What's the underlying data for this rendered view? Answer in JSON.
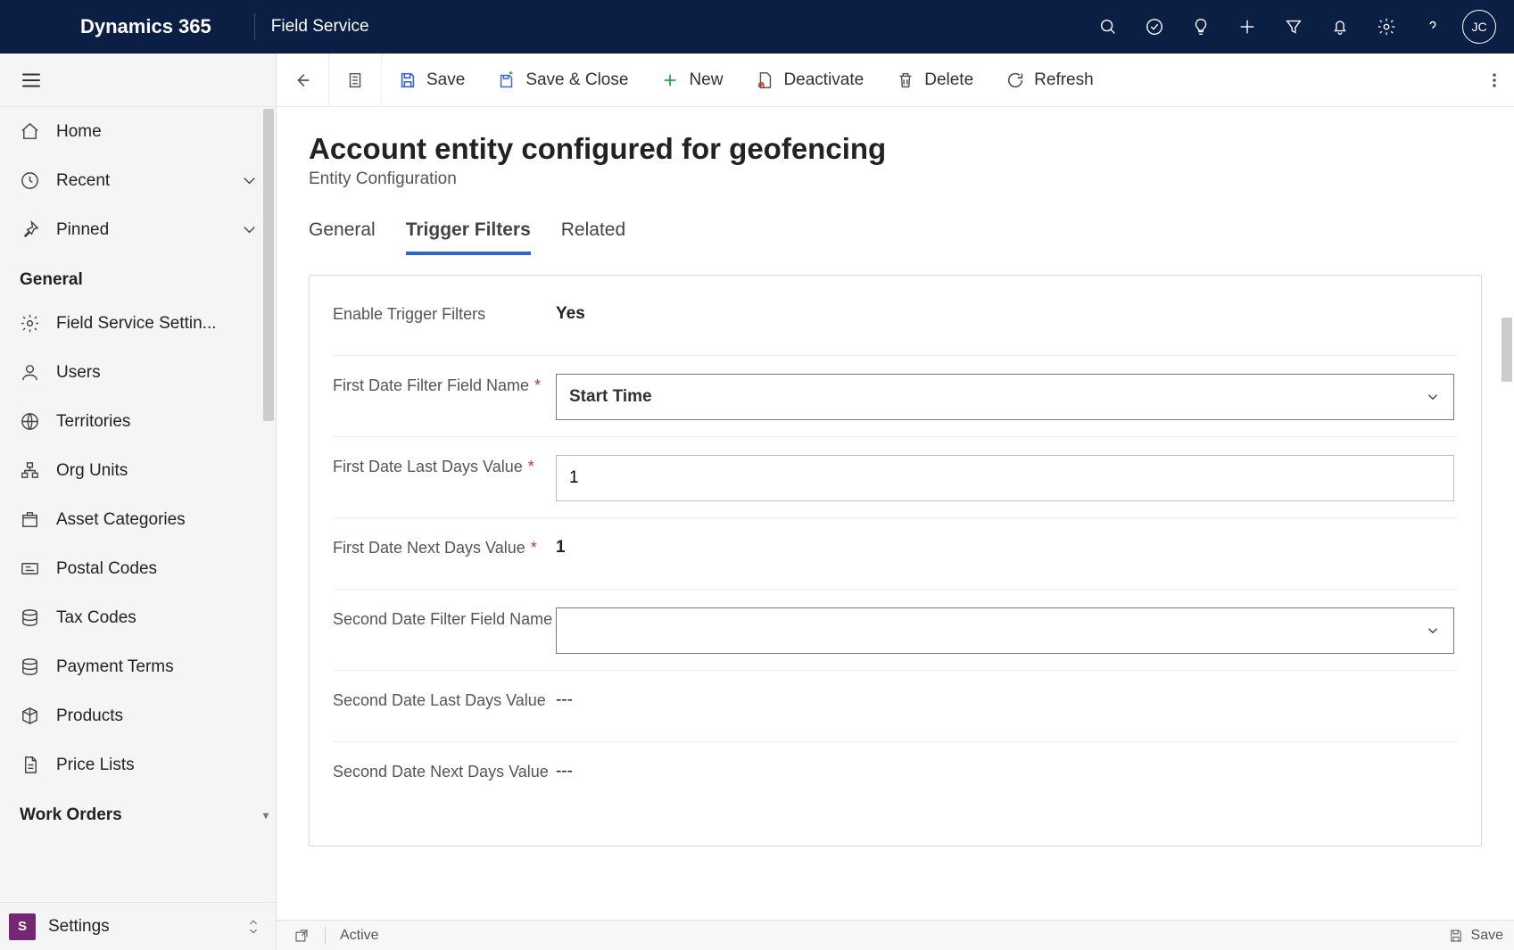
{
  "header": {
    "app_title": "Dynamics 365",
    "module": "Field Service",
    "avatar_initials": "JC"
  },
  "sidebar": {
    "items": [
      {
        "label": "Home",
        "icon": "home"
      },
      {
        "label": "Recent",
        "icon": "clock",
        "expandable": true
      },
      {
        "label": "Pinned",
        "icon": "pin",
        "expandable": true
      }
    ],
    "section_general": "General",
    "general_items": [
      {
        "label": "Field Service Settin...",
        "icon": "gear"
      },
      {
        "label": "Users",
        "icon": "person"
      },
      {
        "label": "Territories",
        "icon": "globe"
      },
      {
        "label": "Org Units",
        "icon": "org"
      },
      {
        "label": "Asset Categories",
        "icon": "box"
      },
      {
        "label": "Postal Codes",
        "icon": "card"
      },
      {
        "label": "Tax Codes",
        "icon": "stack"
      },
      {
        "label": "Payment Terms",
        "icon": "stack"
      },
      {
        "label": "Products",
        "icon": "cube"
      },
      {
        "label": "Price Lists",
        "icon": "doc"
      }
    ],
    "section_work_orders": "Work Orders",
    "area_label": "Settings",
    "area_badge": "S"
  },
  "commands": {
    "save": "Save",
    "save_close": "Save & Close",
    "new": "New",
    "deactivate": "Deactivate",
    "delete": "Delete",
    "refresh": "Refresh"
  },
  "page": {
    "title": "Account entity configured for geofencing",
    "subtitle": "Entity Configuration"
  },
  "tabs": {
    "general": "General",
    "trigger_filters": "Trigger Filters",
    "related": "Related"
  },
  "form": {
    "enable_trigger_filters_label": "Enable Trigger Filters",
    "enable_trigger_filters_value": "Yes",
    "first_date_filter_field_label": "First Date Filter Field Name",
    "first_date_filter_field_value": "Start Time",
    "first_date_last_days_label": "First Date Last Days Value",
    "first_date_last_days_value": "1",
    "first_date_next_days_label": "First Date Next Days Value",
    "first_date_next_days_value": "1",
    "second_date_filter_field_label": "Second Date Filter Field Name",
    "second_date_filter_field_value": "",
    "second_date_last_days_label": "Second Date Last Days Value",
    "second_date_last_days_value": "---",
    "second_date_next_days_label": "Second Date Next Days Value",
    "second_date_next_days_value": "---"
  },
  "footer": {
    "status": "Active",
    "save": "Save"
  }
}
